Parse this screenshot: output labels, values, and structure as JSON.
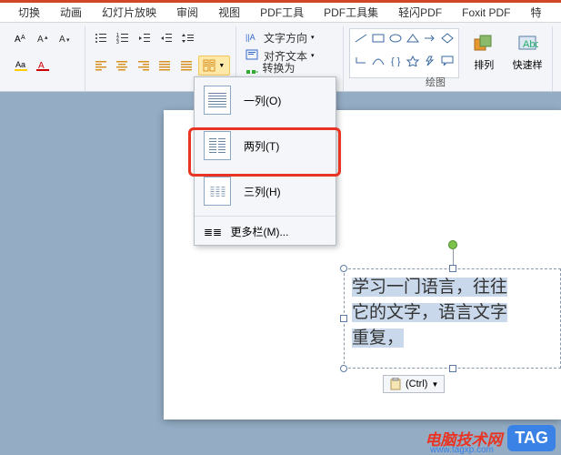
{
  "tabs": [
    "切换",
    "动画",
    "幻灯片放映",
    "审阅",
    "视图",
    "PDF工具",
    "PDF工具集",
    "轻闪PDF",
    "Foxit PDF",
    "特"
  ],
  "para_menu": {
    "text_direction": "文字方向",
    "align_text": "对齐文本",
    "convert_smartart": "转换为 SmartArt"
  },
  "columns_dropdown": {
    "items": [
      {
        "label": "一列(O)"
      },
      {
        "label": "两列(T)"
      },
      {
        "label": "三列(H)"
      }
    ],
    "more": "更多栏(M)..."
  },
  "ribbon_groups": {
    "drawing_label": "绘图",
    "arrange": "排列",
    "quick_style": "快速样"
  },
  "textbox_lines": [
    "学习一门语言，往往",
    "它的文字，语言文字",
    "重复，"
  ],
  "paste_options": "(Ctrl)",
  "watermark": {
    "text": "电脑技术网",
    "tag": "TAG",
    "url": "www.tagxp.com"
  }
}
